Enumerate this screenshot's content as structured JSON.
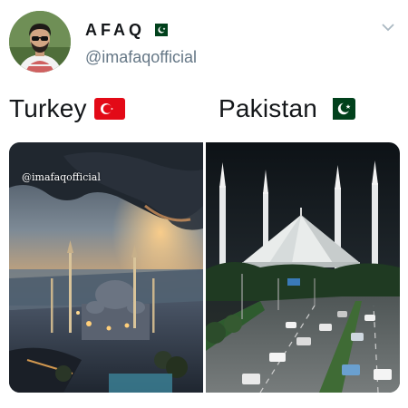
{
  "tweet": {
    "display_name": "AFAQ",
    "handle": "@imafaqofficial",
    "menu_icon": "chevron-down-icon",
    "avatar_icon": "profile-photo"
  },
  "labels": {
    "left": "Turkey",
    "right": "Pakistan",
    "left_flag": "turkey-flag-icon",
    "right_flag": "pakistan-flag-icon"
  },
  "images": {
    "left_watermark": "@imafaqofficial",
    "left_description_icon": "istanbul-mosque-photo",
    "right_description_icon": "islamabad-faisal-mosque-photo"
  },
  "colors": {
    "text_primary": "#14171a",
    "text_secondary": "#657786",
    "pakistan_green": "#01411c",
    "turkey_red": "#e30a17"
  }
}
